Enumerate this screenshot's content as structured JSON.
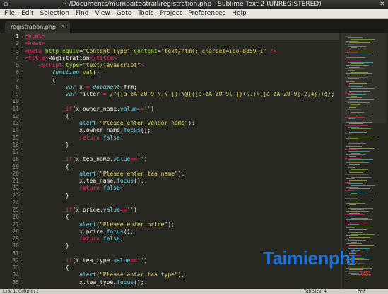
{
  "window": {
    "title": "~/Documents/mumbaiteatrail/registration.php - Sublime Text 2 (UNREGISTERED)"
  },
  "menu": [
    "File",
    "Edit",
    "Selection",
    "Find",
    "View",
    "Goto",
    "Tools",
    "Project",
    "Preferences",
    "Help"
  ],
  "tab": {
    "label": "registration.php",
    "close": "×"
  },
  "lines": [
    {
      "n": "1",
      "parts": [
        [
          "tg",
          "<html>"
        ]
      ]
    },
    {
      "n": "2",
      "parts": [
        [
          "tg",
          "<head>"
        ]
      ]
    },
    {
      "n": "3",
      "parts": [
        [
          "tg",
          "<meta "
        ],
        [
          "at",
          "http-equiv"
        ],
        [
          "",
          "="
        ],
        [
          "st",
          "\"Content-Type\""
        ],
        [
          "at",
          " content"
        ],
        [
          "",
          "="
        ],
        [
          "st",
          "\"text/html; charset=iso-8859-1\""
        ],
        [
          "",
          " "
        ],
        [
          "tg",
          "/>"
        ]
      ]
    },
    {
      "n": "4",
      "parts": [
        [
          "tg",
          "<title>"
        ],
        [
          "",
          "Registration"
        ],
        [
          "tg",
          "</title>"
        ]
      ]
    },
    {
      "n": "5",
      "parts": [
        [
          "",
          "    "
        ],
        [
          "tg",
          "<script "
        ],
        [
          "at",
          "type"
        ],
        [
          "",
          "="
        ],
        [
          "st",
          "\"text/javascript\""
        ],
        [
          "tg",
          ">"
        ]
      ]
    },
    {
      "n": "6",
      "parts": [
        [
          "",
          "        "
        ],
        [
          "kw",
          "function "
        ],
        [
          "fn",
          "val"
        ],
        [
          "",
          "()"
        ]
      ]
    },
    {
      "n": "7",
      "parts": [
        [
          "",
          "        {"
        ]
      ]
    },
    {
      "n": "8",
      "parts": [
        [
          "",
          "            "
        ],
        [
          "kw",
          "var "
        ],
        [
          "",
          "x "
        ],
        [
          "op",
          "="
        ],
        [
          "",
          " "
        ],
        [
          "kw",
          "document"
        ],
        [
          "",
          ".frm;"
        ]
      ]
    },
    {
      "n": "9",
      "parts": [
        [
          "",
          "            "
        ],
        [
          "kw",
          "var "
        ],
        [
          "",
          "filter "
        ],
        [
          "op",
          "="
        ],
        [
          "",
          " "
        ],
        [
          "rg",
          "/^([a-zA-Z0-9_\\.\\-])+\\@(([a-zA-Z0-9\\-])+\\.)+([a-zA-Z0-9]{2,4})+$/"
        ],
        [
          "",
          ";"
        ]
      ]
    },
    {
      "n": "10",
      "parts": [
        [
          "",
          ""
        ]
      ]
    },
    {
      "n": "11",
      "parts": [
        [
          "",
          "            "
        ],
        [
          "ky",
          "if"
        ],
        [
          "",
          "(x.owner_name."
        ],
        [
          "vr",
          "value"
        ],
        [
          "op",
          "=="
        ],
        [
          "st",
          "''"
        ],
        [
          "",
          ")"
        ]
      ]
    },
    {
      "n": "12",
      "parts": [
        [
          "",
          "            {"
        ]
      ]
    },
    {
      "n": "13",
      "parts": [
        [
          "",
          "                "
        ],
        [
          "vr",
          "alert"
        ],
        [
          "",
          "("
        ],
        [
          "st",
          "\"Please enter vendor name\""
        ],
        [
          "",
          ");"
        ]
      ]
    },
    {
      "n": "14",
      "parts": [
        [
          "",
          "                x.owner_name."
        ],
        [
          "vr",
          "focus"
        ],
        [
          "",
          "();"
        ]
      ]
    },
    {
      "n": "15",
      "parts": [
        [
          "",
          "                "
        ],
        [
          "ky",
          "return "
        ],
        [
          "vr",
          "false"
        ],
        [
          "",
          ";"
        ]
      ]
    },
    {
      "n": "16",
      "parts": [
        [
          "",
          "            }"
        ]
      ]
    },
    {
      "n": "17",
      "parts": [
        [
          "",
          ""
        ]
      ]
    },
    {
      "n": "18",
      "parts": [
        [
          "",
          "            "
        ],
        [
          "ky",
          "if"
        ],
        [
          "",
          "(x.tea_name."
        ],
        [
          "vr",
          "value"
        ],
        [
          "op",
          "=="
        ],
        [
          "st",
          "''"
        ],
        [
          "",
          ")"
        ]
      ]
    },
    {
      "n": "19",
      "parts": [
        [
          "",
          "            {"
        ]
      ]
    },
    {
      "n": "20",
      "parts": [
        [
          "",
          "                "
        ],
        [
          "vr",
          "alert"
        ],
        [
          "",
          "("
        ],
        [
          "st",
          "\"Please enter tea name\""
        ],
        [
          "",
          ");"
        ]
      ]
    },
    {
      "n": "21",
      "parts": [
        [
          "",
          "                x.tea_name."
        ],
        [
          "vr",
          "focus"
        ],
        [
          "",
          "();"
        ]
      ]
    },
    {
      "n": "22",
      "parts": [
        [
          "",
          "                "
        ],
        [
          "ky",
          "return "
        ],
        [
          "vr",
          "false"
        ],
        [
          "",
          ";"
        ]
      ]
    },
    {
      "n": "23",
      "parts": [
        [
          "",
          "            }"
        ]
      ]
    },
    {
      "n": "24",
      "parts": [
        [
          "",
          ""
        ]
      ]
    },
    {
      "n": "25",
      "parts": [
        [
          "",
          "            "
        ],
        [
          "ky",
          "if"
        ],
        [
          "",
          "(x.price."
        ],
        [
          "vr",
          "value"
        ],
        [
          "op",
          "=="
        ],
        [
          "st",
          "''"
        ],
        [
          "",
          ")"
        ]
      ]
    },
    {
      "n": "26",
      "parts": [
        [
          "",
          "            {"
        ]
      ]
    },
    {
      "n": "27",
      "parts": [
        [
          "",
          "                "
        ],
        [
          "vr",
          "alert"
        ],
        [
          "",
          "("
        ],
        [
          "st",
          "\"Please enter price\""
        ],
        [
          "",
          ");"
        ]
      ]
    },
    {
      "n": "28",
      "parts": [
        [
          "",
          "                x.price."
        ],
        [
          "vr",
          "focus"
        ],
        [
          "",
          "();"
        ]
      ]
    },
    {
      "n": "29",
      "parts": [
        [
          "",
          "                "
        ],
        [
          "ky",
          "return "
        ],
        [
          "vr",
          "false"
        ],
        [
          "",
          ";"
        ]
      ]
    },
    {
      "n": "30",
      "parts": [
        [
          "",
          "            }"
        ]
      ]
    },
    {
      "n": "31",
      "parts": [
        [
          "",
          ""
        ]
      ]
    },
    {
      "n": "32",
      "parts": [
        [
          "",
          "            "
        ],
        [
          "ky",
          "if"
        ],
        [
          "",
          "(x.tea_type."
        ],
        [
          "vr",
          "value"
        ],
        [
          "op",
          "=="
        ],
        [
          "st",
          "''"
        ],
        [
          "",
          ")"
        ]
      ]
    },
    {
      "n": "33",
      "parts": [
        [
          "",
          "            {"
        ]
      ]
    },
    {
      "n": "34",
      "parts": [
        [
          "",
          "                "
        ],
        [
          "vr",
          "alert"
        ],
        [
          "",
          "("
        ],
        [
          "st",
          "\"Please enter tea type\""
        ],
        [
          "",
          ");"
        ]
      ]
    },
    {
      "n": "35",
      "parts": [
        [
          "",
          "                x.tea_type."
        ],
        [
          "vr",
          "focus"
        ],
        [
          "",
          "();"
        ]
      ]
    }
  ],
  "watermark": {
    "name": "Taimienphi",
    "sub": ".vn"
  },
  "status": {
    "position": "Line 1, Column 1",
    "tab_size": "Tab Size: 4",
    "syntax": "PHP"
  },
  "colors": {
    "background": "#272822",
    "tag": "#f92672",
    "attribute": "#a6e22e",
    "string": "#e6db74",
    "keyword": "#66d9ef"
  }
}
